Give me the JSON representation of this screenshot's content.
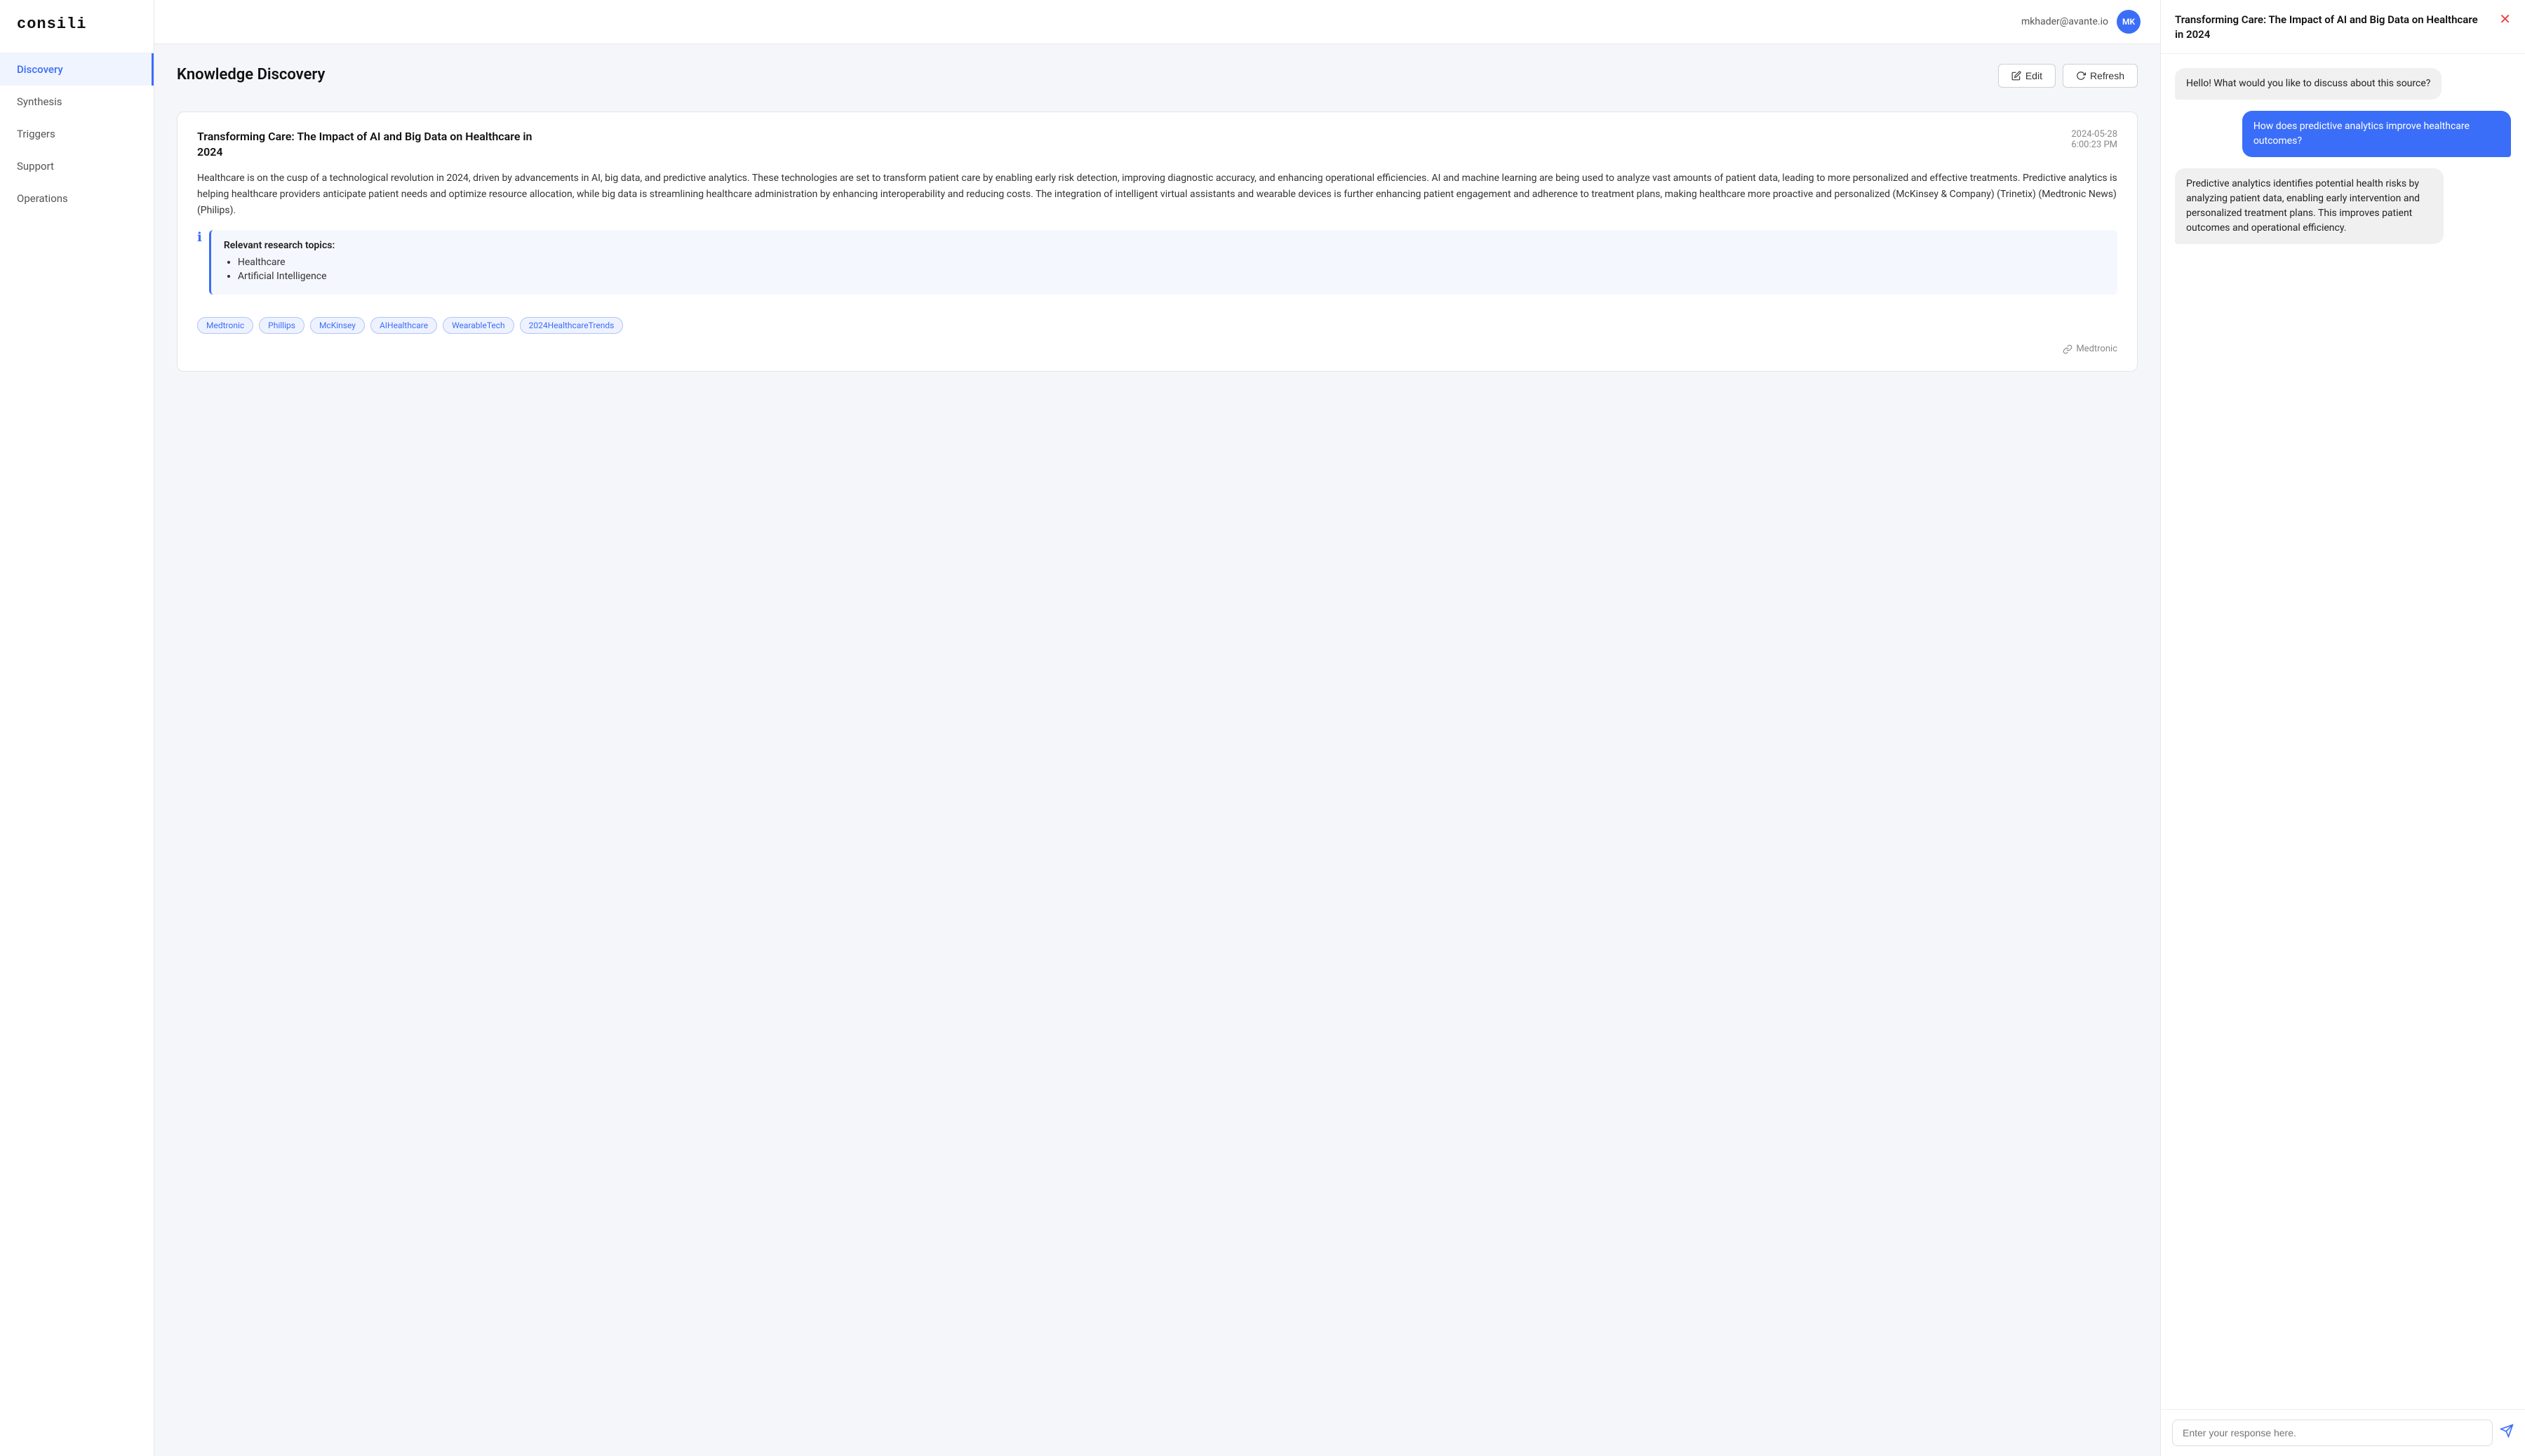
{
  "app": {
    "logo": "consili",
    "user_email": "mkhader@avante.io",
    "user_initials": "MK"
  },
  "sidebar": {
    "items": [
      {
        "id": "discovery",
        "label": "Discovery",
        "active": true
      },
      {
        "id": "synthesis",
        "label": "Synthesis",
        "active": false
      },
      {
        "id": "triggers",
        "label": "Triggers",
        "active": false
      },
      {
        "id": "support",
        "label": "Support",
        "active": false
      },
      {
        "id": "operations",
        "label": "Operations",
        "active": false
      }
    ]
  },
  "page": {
    "title": "Knowledge Discovery"
  },
  "toolbar": {
    "edit_label": "Edit",
    "refresh_label": "Refresh"
  },
  "card": {
    "title": "Transforming Care: The Impact of AI and Big Data on Healthcare in 2024",
    "date": "2024-05-28",
    "time": "6:00:23 PM",
    "body": "Healthcare is on the cusp of a technological revolution in 2024, driven by advancements in AI, big data, and predictive analytics. These technologies are set to transform patient care by enabling early risk detection, improving diagnostic accuracy, and enhancing operational efficiencies. AI and machine learning are being used to analyze vast amounts of patient data, leading to more personalized and effective treatments. Predictive analytics is helping healthcare providers anticipate patient needs and optimize resource allocation, while big data is streamlining healthcare administration by enhancing interoperability and reducing costs. The integration of intelligent virtual assistants and wearable devices is further enhancing patient engagement and adherence to treatment plans, making healthcare more proactive and personalized (McKinsey & Company) (Trinetix) (Medtronic News) (Philips).",
    "info_title": "Relevant research topics:",
    "topics": [
      "Healthcare",
      "Artificial Intelligence"
    ],
    "tags": [
      "Medtronic",
      "Phillips",
      "McKinsey",
      "AIHealthcare",
      "WearableTech",
      "2024HealthcareTrends"
    ],
    "source": "Medtronic"
  },
  "panel": {
    "title": "Transforming Care: The Impact of AI and Big Data on Healthcare in 2024",
    "messages": [
      {
        "role": "assistant",
        "text": "Hello! What would you like to discuss about this source?"
      },
      {
        "role": "user",
        "text": "How does predictive analytics improve healthcare outcomes?"
      },
      {
        "role": "assistant",
        "text": "Predictive analytics identifies potential health risks by analyzing patient data, enabling early intervention and personalized treatment plans. This improves patient outcomes and operational efficiency."
      }
    ],
    "input_placeholder": "Enter your response here."
  }
}
